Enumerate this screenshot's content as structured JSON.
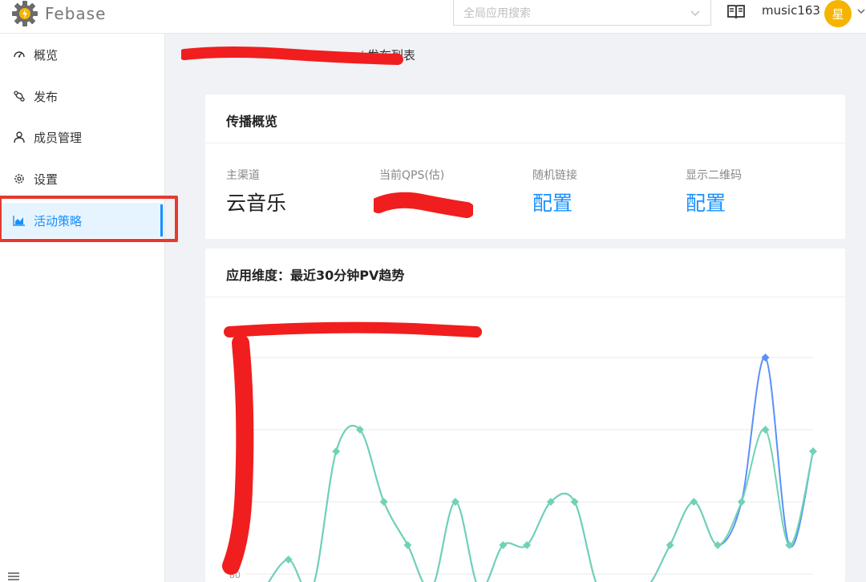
{
  "header": {
    "app_name": "Febase",
    "search": {
      "placeholder": "全局应用搜索"
    },
    "username": "music163",
    "avatar_text": "星",
    "icons": [
      "gear-logo-icon",
      "chevron-down-icon",
      "book-icon"
    ]
  },
  "sidebar": {
    "items": [
      {
        "label": "概览",
        "icon": "dashboard-icon",
        "active": false
      },
      {
        "label": "发布",
        "icon": "branch-icon",
        "active": false
      },
      {
        "label": "成员管理",
        "icon": "user-icon",
        "active": false
      },
      {
        "label": "设置",
        "icon": "gear-icon",
        "active": false
      },
      {
        "label": "活动策略",
        "icon": "area-chart-icon",
        "active": true
      }
    ],
    "highlight_color": "#e53a32"
  },
  "breadcrumb": {
    "last": "发布列表",
    "separator": "/"
  },
  "overview_card": {
    "title": "传播概览",
    "stats": [
      {
        "label": "主渠道",
        "value": "云音乐",
        "is_link": false
      },
      {
        "label": "当前QPS(估)",
        "value": "",
        "is_link": false
      },
      {
        "label": "随机链接",
        "value": "配置",
        "is_link": true
      },
      {
        "label": "显示二维码",
        "value": "配置",
        "is_link": true
      }
    ],
    "link_color": "#1890ff"
  },
  "trend_card": {
    "title": "应用维度：最近30分钟PV趋势"
  },
  "chart_data": {
    "type": "line",
    "title": "",
    "xlabel": "",
    "ylabel": "",
    "ytick_visible": "80",
    "ylim": [
      80,
      230
    ],
    "grid": true,
    "x": [
      0,
      1,
      2,
      3,
      4,
      5,
      6,
      7,
      8,
      9,
      10,
      11,
      12,
      13,
      14,
      15,
      16,
      17,
      18,
      19,
      20,
      21,
      22,
      23
    ],
    "series": [
      {
        "color": "#6fd3b4",
        "values": [
          70,
          90,
          70,
          165,
          180,
          130,
          100,
          70,
          130,
          70,
          100,
          100,
          130,
          130,
          70,
          70,
          70,
          100,
          130,
          100,
          130,
          180,
          100,
          165
        ]
      },
      {
        "color": "#5b8ff9",
        "values": [
          70,
          90,
          70,
          165,
          180,
          130,
          100,
          70,
          130,
          70,
          100,
          100,
          130,
          130,
          70,
          70,
          70,
          100,
          130,
          100,
          130,
          230,
          100,
          165
        ]
      }
    ]
  }
}
